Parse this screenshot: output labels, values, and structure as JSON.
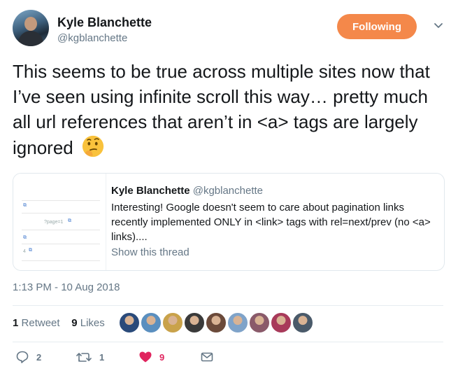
{
  "author": {
    "display_name": "Kyle Blanchette",
    "handle": "@kgblanchette"
  },
  "follow_button": {
    "label": "Following",
    "color": "#f4884a"
  },
  "tweet": {
    "text": "This seems to be true across multiple sites now that I’ve seen using infinite scroll this way… pretty much all url references that aren’t in <a> tags are largely ignored",
    "emoji": "thinking-face-icon"
  },
  "quoted_tweet": {
    "display_name": "Kyle Blanchette",
    "handle": "@kgblanchette",
    "text": "Interesting! Google doesn't seem to care about pagination links recently implemented ONLY in <link> tags with rel=next/prev (no <a> links)....",
    "show_thread": "Show this thread",
    "media_labels": [
      "?page=1",
      "4"
    ]
  },
  "timestamp": "1:13 PM - 10 Aug 2018",
  "stats": {
    "retweets_count": "1",
    "retweets_label": "Retweet",
    "likes_count": "9",
    "likes_label": "Likes"
  },
  "likers": [
    "#2a4a7a",
    "#5a8fbf",
    "#c9a24a",
    "#3a3a3a",
    "#6b4a3a",
    "#7fa3c9",
    "#8a5a6a",
    "#a83a5a",
    "#4a5a6a"
  ],
  "actions": {
    "reply_count": "2",
    "retweet_count": "1",
    "like_count": "9",
    "like_color": "#e0245e"
  }
}
